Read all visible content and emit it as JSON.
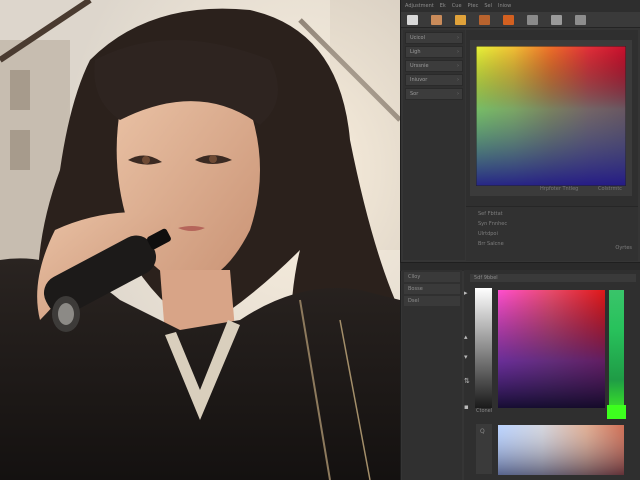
{
  "app": {
    "menu_items": [
      "Adjustment",
      "Ek",
      "Cue",
      "Ptec",
      "Sel",
      "Iniow"
    ]
  },
  "toolbar": {
    "buttons": [
      {
        "icon": "document-icon",
        "color": "#d9d9d9"
      },
      {
        "icon": "layer-icon",
        "color": "#c98b5a"
      },
      {
        "icon": "play-icon",
        "color": "#e0a23a"
      },
      {
        "icon": "brush-icon",
        "color": "#b8632e"
      },
      {
        "icon": "swatch-icon",
        "color": "#d36020"
      },
      {
        "icon": "lock-icon",
        "color": "#8a8a8a"
      },
      {
        "icon": "eye-icon",
        "color": "#9a9a9a"
      },
      {
        "icon": "grid-icon",
        "color": "#8d8d8d"
      }
    ]
  },
  "layers": {
    "rows": [
      {
        "label": "Ucicol",
        "mark": "›"
      },
      {
        "label": "Ligh",
        "mark": "›"
      },
      {
        "label": "Urssnie",
        "mark": "›"
      },
      {
        "label": "Iniuvor",
        "mark": "›"
      },
      {
        "label": "Sor",
        "mark": "›"
      }
    ]
  },
  "palette": {
    "caption": "Hrpfoter Tntleg",
    "caption_right": "Colstrmtc"
  },
  "info": {
    "lines": [
      "Sef Fbttat",
      "Syn Fnnhec",
      "Ulrtdpoi",
      "Brr Salcne"
    ],
    "tag": "Oyrtes"
  },
  "lower": {
    "left_rows": [
      "Clloy",
      "Bosse",
      "Dsel"
    ],
    "strip_label": "5df 9bbel",
    "ps_label": "Ctonel",
    "swatch_label": "Q"
  },
  "colors": {
    "panel_bg": "#353535",
    "hue_accent": "#3dff1e"
  }
}
